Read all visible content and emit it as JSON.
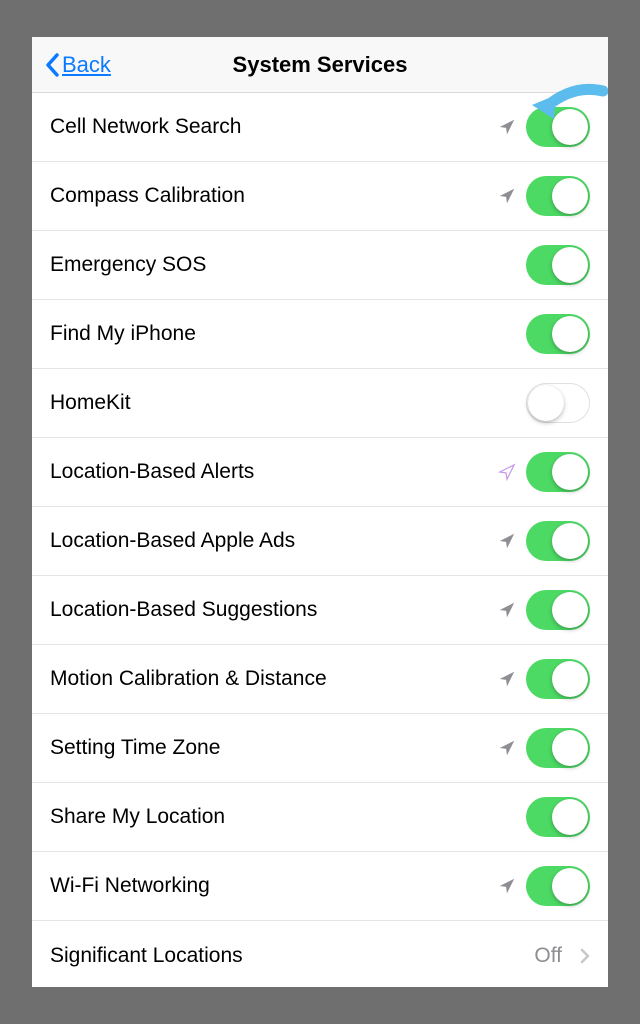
{
  "navbar": {
    "back_label": "Back",
    "title": "System Services"
  },
  "rows": [
    {
      "label": "Cell Network Search",
      "arrow": "gray",
      "toggle": "on"
    },
    {
      "label": "Compass Calibration",
      "arrow": "gray",
      "toggle": "on"
    },
    {
      "label": "Emergency SOS",
      "arrow": "none",
      "toggle": "on"
    },
    {
      "label": "Find My iPhone",
      "arrow": "none",
      "toggle": "on"
    },
    {
      "label": "HomeKit",
      "arrow": "none",
      "toggle": "off"
    },
    {
      "label": "Location-Based Alerts",
      "arrow": "outline",
      "toggle": "on"
    },
    {
      "label": "Location-Based Apple Ads",
      "arrow": "gray",
      "toggle": "on"
    },
    {
      "label": "Location-Based Suggestions",
      "arrow": "gray",
      "toggle": "on"
    },
    {
      "label": "Motion Calibration & Distance",
      "arrow": "gray",
      "toggle": "on"
    },
    {
      "label": "Setting Time Zone",
      "arrow": "gray",
      "toggle": "on"
    },
    {
      "label": "Share My Location",
      "arrow": "none",
      "toggle": "on"
    },
    {
      "label": "Wi-Fi Networking",
      "arrow": "gray",
      "toggle": "on"
    }
  ],
  "nav_row": {
    "label": "Significant Locations",
    "value": "Off"
  },
  "colors": {
    "toggle_on": "#4cd964",
    "link": "#0a7aff",
    "secondary": "#8e8e93",
    "arrow_gray": "#8e8e93",
    "arrow_outline": "#c597e8",
    "annotation": "#5bbced"
  }
}
